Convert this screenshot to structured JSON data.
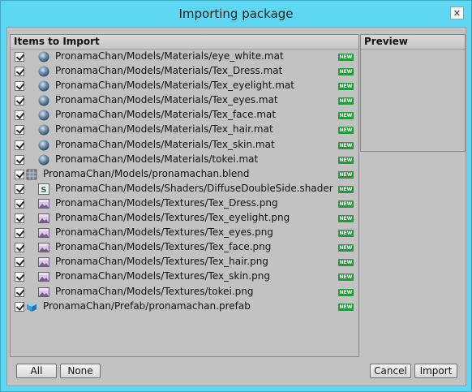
{
  "window": {
    "title": "Importing package"
  },
  "items_panel": {
    "header": "Items to Import"
  },
  "preview_panel": {
    "header": "Preview"
  },
  "badge_label": "NEW",
  "items": [
    {
      "icon": "material-sphere-icon",
      "indent": 1,
      "label": "PronamaChan/Models/Materials/eye_white.mat",
      "checked": true,
      "is_new": true
    },
    {
      "icon": "material-sphere-icon",
      "indent": 1,
      "label": "PronamaChan/Models/Materials/Tex_Dress.mat",
      "checked": true,
      "is_new": true
    },
    {
      "icon": "material-sphere-icon",
      "indent": 1,
      "label": "PronamaChan/Models/Materials/Tex_eyelight.mat",
      "checked": true,
      "is_new": true
    },
    {
      "icon": "material-sphere-icon",
      "indent": 1,
      "label": "PronamaChan/Models/Materials/Tex_eyes.mat",
      "checked": true,
      "is_new": true
    },
    {
      "icon": "material-sphere-icon",
      "indent": 1,
      "label": "PronamaChan/Models/Materials/Tex_face.mat",
      "checked": true,
      "is_new": true
    },
    {
      "icon": "material-sphere-icon",
      "indent": 1,
      "label": "PronamaChan/Models/Materials/Tex_hair.mat",
      "checked": true,
      "is_new": true
    },
    {
      "icon": "material-sphere-icon",
      "indent": 1,
      "label": "PronamaChan/Models/Materials/Tex_skin.mat",
      "checked": true,
      "is_new": true
    },
    {
      "icon": "material-sphere-icon",
      "indent": 1,
      "label": "PronamaChan/Models/Materials/tokei.mat",
      "checked": true,
      "is_new": true
    },
    {
      "icon": "model-grid-icon",
      "indent": 0,
      "label": "PronamaChan/Models/pronamachan.blend",
      "checked": true,
      "is_new": true
    },
    {
      "icon": "shader-icon",
      "indent": 1,
      "label": "PronamaChan/Models/Shaders/DiffuseDoubleSide.shader",
      "checked": true,
      "is_new": true
    },
    {
      "icon": "texture-image-icon",
      "indent": 1,
      "label": "PronamaChan/Models/Textures/Tex_Dress.png",
      "checked": true,
      "is_new": true
    },
    {
      "icon": "texture-image-icon",
      "indent": 1,
      "label": "PronamaChan/Models/Textures/Tex_eyelight.png",
      "checked": true,
      "is_new": true
    },
    {
      "icon": "texture-image-icon",
      "indent": 1,
      "label": "PronamaChan/Models/Textures/Tex_eyes.png",
      "checked": true,
      "is_new": true
    },
    {
      "icon": "texture-image-icon",
      "indent": 1,
      "label": "PronamaChan/Models/Textures/Tex_face.png",
      "checked": true,
      "is_new": true
    },
    {
      "icon": "texture-image-icon",
      "indent": 1,
      "label": "PronamaChan/Models/Textures/Tex_hair.png",
      "checked": true,
      "is_new": true
    },
    {
      "icon": "texture-image-icon",
      "indent": 1,
      "label": "PronamaChan/Models/Textures/Tex_skin.png",
      "checked": true,
      "is_new": true
    },
    {
      "icon": "texture-image-icon",
      "indent": 1,
      "label": "PronamaChan/Models/Textures/tokei.png",
      "checked": true,
      "is_new": true
    },
    {
      "icon": "prefab-cube-icon",
      "indent": 0,
      "label": "PronamaChan/Prefab/pronamachan.prefab",
      "checked": true,
      "is_new": true
    }
  ],
  "buttons": {
    "all": "All",
    "none": "None",
    "cancel": "Cancel",
    "import": "Import"
  },
  "colors": {
    "titlebar": "#5ed8f2",
    "panel_bg": "#c2c2c2",
    "new_badge": "#1f9b3a"
  }
}
